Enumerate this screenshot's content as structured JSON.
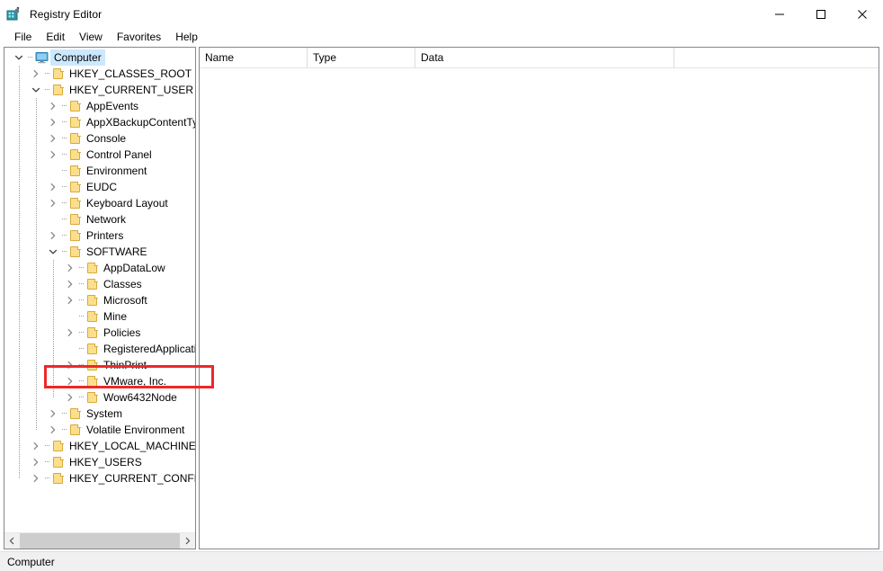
{
  "window": {
    "title": "Registry Editor",
    "icon": "regedit-icon",
    "minimize_label": "–",
    "maximize_label": "□",
    "close_label": "✕"
  },
  "menu": {
    "items": [
      {
        "label": "File",
        "name": "menu-file"
      },
      {
        "label": "Edit",
        "name": "menu-edit"
      },
      {
        "label": "View",
        "name": "menu-view"
      },
      {
        "label": "Favorites",
        "name": "menu-favorites"
      },
      {
        "label": "Help",
        "name": "menu-help"
      }
    ]
  },
  "tree": {
    "nodes": [
      {
        "label": "Computer",
        "indent": 0,
        "icon": "computer-monitor-icon",
        "expander": "expanded",
        "selected": true
      },
      {
        "label": "HKEY_CLASSES_ROOT",
        "indent": 1,
        "icon": "folder-icon",
        "expander": "collapsed",
        "selected": false
      },
      {
        "label": "HKEY_CURRENT_USER",
        "indent": 1,
        "icon": "folder-icon",
        "expander": "expanded",
        "selected": false
      },
      {
        "label": "AppEvents",
        "indent": 2,
        "icon": "folder-icon",
        "expander": "collapsed",
        "selected": false
      },
      {
        "label": "AppXBackupContentTyp",
        "indent": 2,
        "icon": "folder-icon",
        "expander": "collapsed",
        "selected": false
      },
      {
        "label": "Console",
        "indent": 2,
        "icon": "folder-icon",
        "expander": "collapsed",
        "selected": false
      },
      {
        "label": "Control Panel",
        "indent": 2,
        "icon": "folder-icon",
        "expander": "collapsed",
        "selected": false
      },
      {
        "label": "Environment",
        "indent": 2,
        "icon": "folder-icon",
        "expander": "none",
        "selected": false
      },
      {
        "label": "EUDC",
        "indent": 2,
        "icon": "folder-icon",
        "expander": "collapsed",
        "selected": false
      },
      {
        "label": "Keyboard Layout",
        "indent": 2,
        "icon": "folder-icon",
        "expander": "collapsed",
        "selected": false
      },
      {
        "label": "Network",
        "indent": 2,
        "icon": "folder-icon",
        "expander": "none",
        "selected": false
      },
      {
        "label": "Printers",
        "indent": 2,
        "icon": "folder-icon",
        "expander": "collapsed",
        "selected": false
      },
      {
        "label": "SOFTWARE",
        "indent": 2,
        "icon": "folder-icon",
        "expander": "expanded",
        "selected": false
      },
      {
        "label": "AppDataLow",
        "indent": 3,
        "icon": "folder-icon",
        "expander": "collapsed",
        "selected": false
      },
      {
        "label": "Classes",
        "indent": 3,
        "icon": "folder-icon",
        "expander": "collapsed",
        "selected": false
      },
      {
        "label": "Microsoft",
        "indent": 3,
        "icon": "folder-icon",
        "expander": "collapsed",
        "selected": false
      },
      {
        "label": "Mine",
        "indent": 3,
        "icon": "folder-icon",
        "expander": "none",
        "selected": false
      },
      {
        "label": "Policies",
        "indent": 3,
        "icon": "folder-icon",
        "expander": "collapsed",
        "selected": false
      },
      {
        "label": "RegisteredApplication",
        "indent": 3,
        "icon": "folder-icon",
        "expander": "none",
        "selected": false
      },
      {
        "label": "ThinPrint",
        "indent": 3,
        "icon": "folder-icon",
        "expander": "collapsed",
        "selected": false
      },
      {
        "label": "VMware, Inc.",
        "indent": 3,
        "icon": "folder-icon",
        "expander": "collapsed",
        "selected": false
      },
      {
        "label": "Wow6432Node",
        "indent": 3,
        "icon": "folder-icon",
        "expander": "collapsed",
        "selected": false
      },
      {
        "label": "System",
        "indent": 2,
        "icon": "folder-icon",
        "expander": "collapsed",
        "selected": false
      },
      {
        "label": "Volatile Environment",
        "indent": 2,
        "icon": "folder-icon",
        "expander": "collapsed",
        "selected": false
      },
      {
        "label": "HKEY_LOCAL_MACHINE",
        "indent": 1,
        "icon": "folder-icon",
        "expander": "collapsed",
        "selected": false
      },
      {
        "label": "HKEY_USERS",
        "indent": 1,
        "icon": "folder-icon",
        "expander": "collapsed",
        "selected": false
      },
      {
        "label": "HKEY_CURRENT_CONFIG",
        "indent": 1,
        "icon": "folder-icon",
        "expander": "collapsed",
        "selected": false
      }
    ],
    "scrollbar": {
      "left_arrow": "‹",
      "right_arrow": "›"
    }
  },
  "list": {
    "columns": [
      "Name",
      "Type",
      "Data",
      ""
    ],
    "rows": []
  },
  "status": {
    "path": "Computer"
  },
  "annotation": {
    "target_label": "VMware, Inc.",
    "color": "#ee2828"
  }
}
